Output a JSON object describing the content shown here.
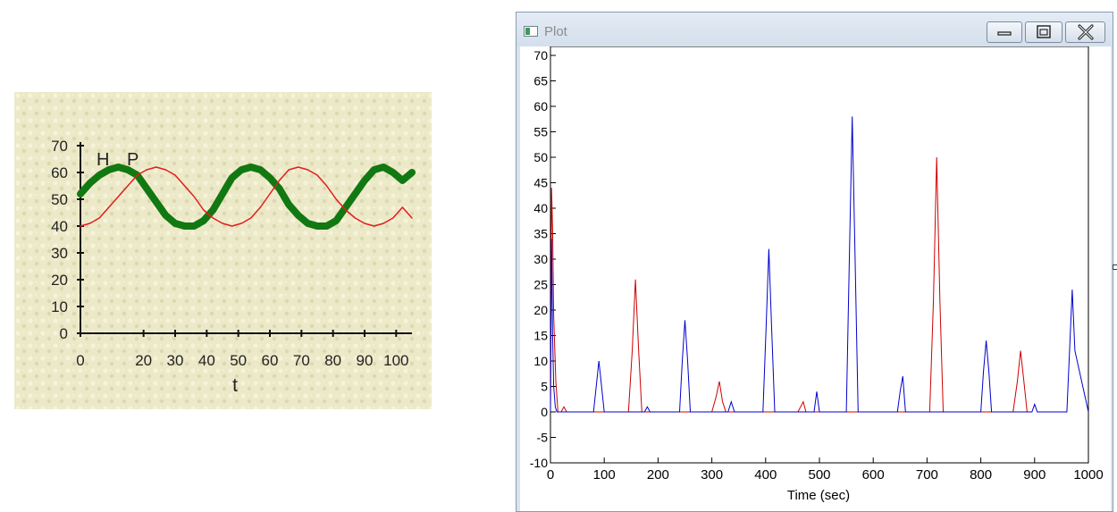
{
  "window": {
    "title": "Plot",
    "icon": "plot-app-icon",
    "controls": [
      "minimize-icon",
      "maximize-icon",
      "close-icon"
    ]
  },
  "chart_data": [
    {
      "type": "line",
      "background": "#ece9c8",
      "xlabel": "t",
      "ylabel": "",
      "xlim": [
        0,
        105
      ],
      "ylim": [
        0,
        70
      ],
      "x_ticks": [
        0,
        20,
        30,
        40,
        50,
        60,
        70,
        80,
        90,
        100
      ],
      "y_ticks": [
        0,
        10,
        20,
        30,
        40,
        50,
        60,
        70
      ],
      "grid": false,
      "series": [
        {
          "name": "H",
          "color": "#127812",
          "x": [
            0,
            3,
            6,
            9,
            12,
            15,
            18,
            21,
            24,
            27,
            30,
            33,
            36,
            39,
            42,
            45,
            48,
            51,
            54,
            57,
            60,
            63,
            66,
            69,
            72,
            75,
            78,
            81,
            84,
            87,
            90,
            93,
            96,
            99,
            102,
            105
          ],
          "values": [
            52,
            56,
            59,
            61,
            62,
            61,
            59,
            54,
            49,
            44,
            41,
            40,
            40,
            42,
            46,
            52,
            58,
            61,
            62,
            61,
            58,
            54,
            48,
            44,
            41,
            40,
            40,
            42,
            47,
            52,
            57,
            61,
            62,
            60,
            57,
            60
          ]
        },
        {
          "name": "P",
          "color": "#e41b1b",
          "x": [
            0,
            3,
            6,
            9,
            12,
            15,
            18,
            21,
            24,
            27,
            30,
            33,
            36,
            39,
            42,
            45,
            48,
            51,
            54,
            57,
            60,
            63,
            66,
            69,
            72,
            75,
            78,
            81,
            84,
            87,
            90,
            93,
            96,
            99,
            102,
            105
          ],
          "values": [
            40,
            41,
            43,
            47,
            51,
            55,
            59,
            61,
            62,
            61,
            59,
            55,
            51,
            46,
            43,
            41,
            40,
            41,
            43,
            47,
            52,
            57,
            61,
            62,
            61,
            59,
            55,
            50,
            46,
            43,
            41,
            40,
            41,
            43,
            47,
            43
          ]
        }
      ]
    },
    {
      "type": "line",
      "title": "",
      "xlabel": "Time (sec)",
      "ylabel": "",
      "xlim": [
        0,
        1000
      ],
      "ylim": [
        -10,
        70
      ],
      "x_ticks": [
        0,
        100,
        200,
        300,
        400,
        500,
        600,
        700,
        800,
        900,
        1000
      ],
      "y_ticks": [
        -10,
        -5,
        0,
        5,
        10,
        15,
        20,
        25,
        30,
        35,
        40,
        45,
        50,
        55,
        60,
        65,
        70
      ],
      "grid": false,
      "series": [
        {
          "color": "#cc0000",
          "x": [
            0,
            2,
            4,
            6,
            10,
            14,
            20,
            25,
            30,
            145,
            152,
            158,
            164,
            170,
            300,
            308,
            314,
            320,
            326,
            460,
            465,
            470,
            475,
            705,
            712,
            718,
            724,
            730,
            860,
            868,
            874,
            880,
            886
          ],
          "values": [
            0,
            44,
            36,
            19,
            6,
            0,
            0,
            1,
            0,
            0,
            12,
            26,
            12,
            0,
            0,
            3,
            6,
            2,
            0,
            0,
            1,
            2,
            0,
            0,
            22,
            50,
            22,
            0,
            0,
            6,
            12,
            6,
            0
          ],
          "peaks": [
            44,
            26,
            6,
            50,
            12
          ]
        },
        {
          "color": "#0000cc",
          "x": [
            0,
            2,
            4,
            6,
            9,
            12,
            80,
            86,
            90,
            94,
            100,
            175,
            180,
            185,
            240,
            245,
            250,
            255,
            260,
            330,
            336,
            342,
            395,
            401,
            406,
            411,
            417,
            490,
            495,
            500,
            550,
            556,
            561,
            566,
            572,
            645,
            650,
            655,
            660,
            800,
            805,
            810,
            815,
            820,
            895,
            900,
            905,
            960,
            965,
            970,
            975,
            1000
          ],
          "values": [
            0,
            34,
            15,
            5,
            1,
            0,
            0,
            6,
            10,
            6,
            0,
            0,
            1,
            0,
            0,
            10,
            18,
            10,
            0,
            0,
            2,
            0,
            0,
            17,
            32,
            17,
            0,
            0,
            4,
            0,
            0,
            32,
            58,
            32,
            0,
            0,
            4,
            7,
            0,
            0,
            8,
            14,
            8,
            0,
            0,
            1.5,
            0,
            0,
            12,
            24,
            12,
            0
          ],
          "peaks": [
            34,
            10,
            18,
            32,
            4,
            58,
            7,
            14,
            24
          ]
        }
      ]
    }
  ]
}
